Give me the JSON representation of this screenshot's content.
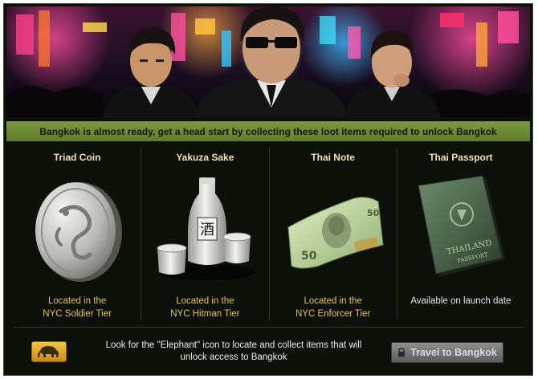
{
  "notice": {
    "text": "Bangkok is almost ready, get a head start by collecting these loot items required to unlock Bangkok"
  },
  "items": [
    {
      "title": "Triad Coin",
      "location_line1": "Located in the",
      "location_line2": "NYC Soldier Tier",
      "icon": "dragon-coin-icon"
    },
    {
      "title": "Yakuza Sake",
      "location_line1": "Located in the",
      "location_line2": "NYC Hitman Tier",
      "icon": "sake-set-icon",
      "sake_glyph": "酒"
    },
    {
      "title": "Thai Note",
      "location_line1": "Located in the",
      "location_line2": "NYC Enforcer Tier",
      "icon": "banknote-icon",
      "note_digits": "50"
    },
    {
      "title": "Thai Passport",
      "location_line1": "Available on launch date",
      "location_line2": "",
      "icon": "passport-icon",
      "passport_word1": "THAILAND",
      "passport_word2": "PASSPORT"
    }
  ],
  "footer": {
    "hint_line1": "Look for the \"Elephant\" icon to locate and collect items that will",
    "hint_line2": "unlock access to Bangkok",
    "elephant_icon": "elephant-icon",
    "travel_label": "Travel to Bangkok",
    "travel_icon": "lock-icon"
  },
  "colors": {
    "background": "#0b1109",
    "notice_bar": "#6f8c34",
    "title_text": "#f0e4b2",
    "location_text": "#e7c449",
    "button_gold": "#e0a92a",
    "button_disabled": "#767676"
  }
}
